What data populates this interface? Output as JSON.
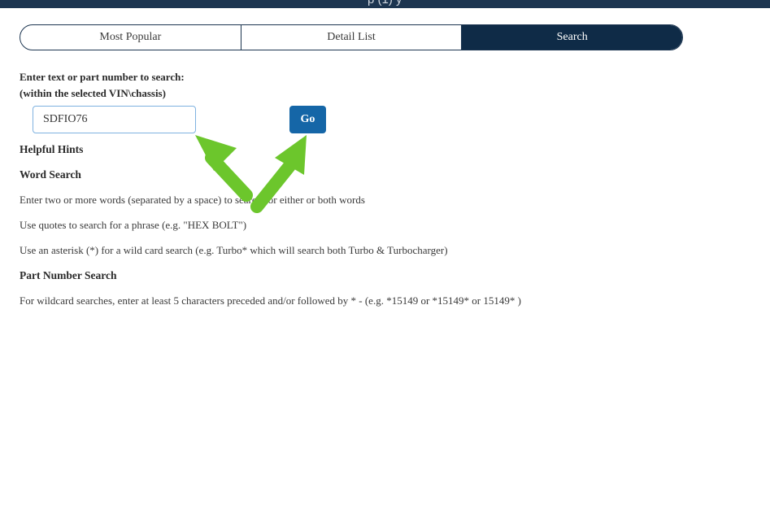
{
  "top_bar": {
    "partial_text": "p  (1)  y"
  },
  "tabs": [
    {
      "label": "Most Popular",
      "active": false
    },
    {
      "label": "Detail List",
      "active": false
    },
    {
      "label": "Search",
      "active": true
    }
  ],
  "search": {
    "prompt_line1": "Enter text or part number to search:",
    "prompt_line2": "(within the selected VIN\\chassis)",
    "input_value": "SDFIO76",
    "go_label": "Go"
  },
  "hints": {
    "title": "Helpful Hints",
    "word_search": {
      "heading": "Word Search",
      "items": [
        "Enter two or more words (separated by a space) to search for either or both words",
        "Use quotes to search for a phrase (e.g. \"HEX BOLT\")",
        "Use an asterisk (*) for a wild card search (e.g. Turbo* which will search both Turbo & Turbocharger)"
      ]
    },
    "part_number_search": {
      "heading": "Part Number Search",
      "text": "For wildcard searches, enter at least 5 characters preceded and/or followed by * - (e.g. *15149 or *15149* or 15149* )"
    }
  },
  "colors": {
    "active_tab": "#0f2b47",
    "go_button": "#1566a7",
    "annotation_arrow": "#6cc62c"
  },
  "annotations": {
    "arrows": [
      "arrow-to-input",
      "arrow-to-go"
    ]
  }
}
